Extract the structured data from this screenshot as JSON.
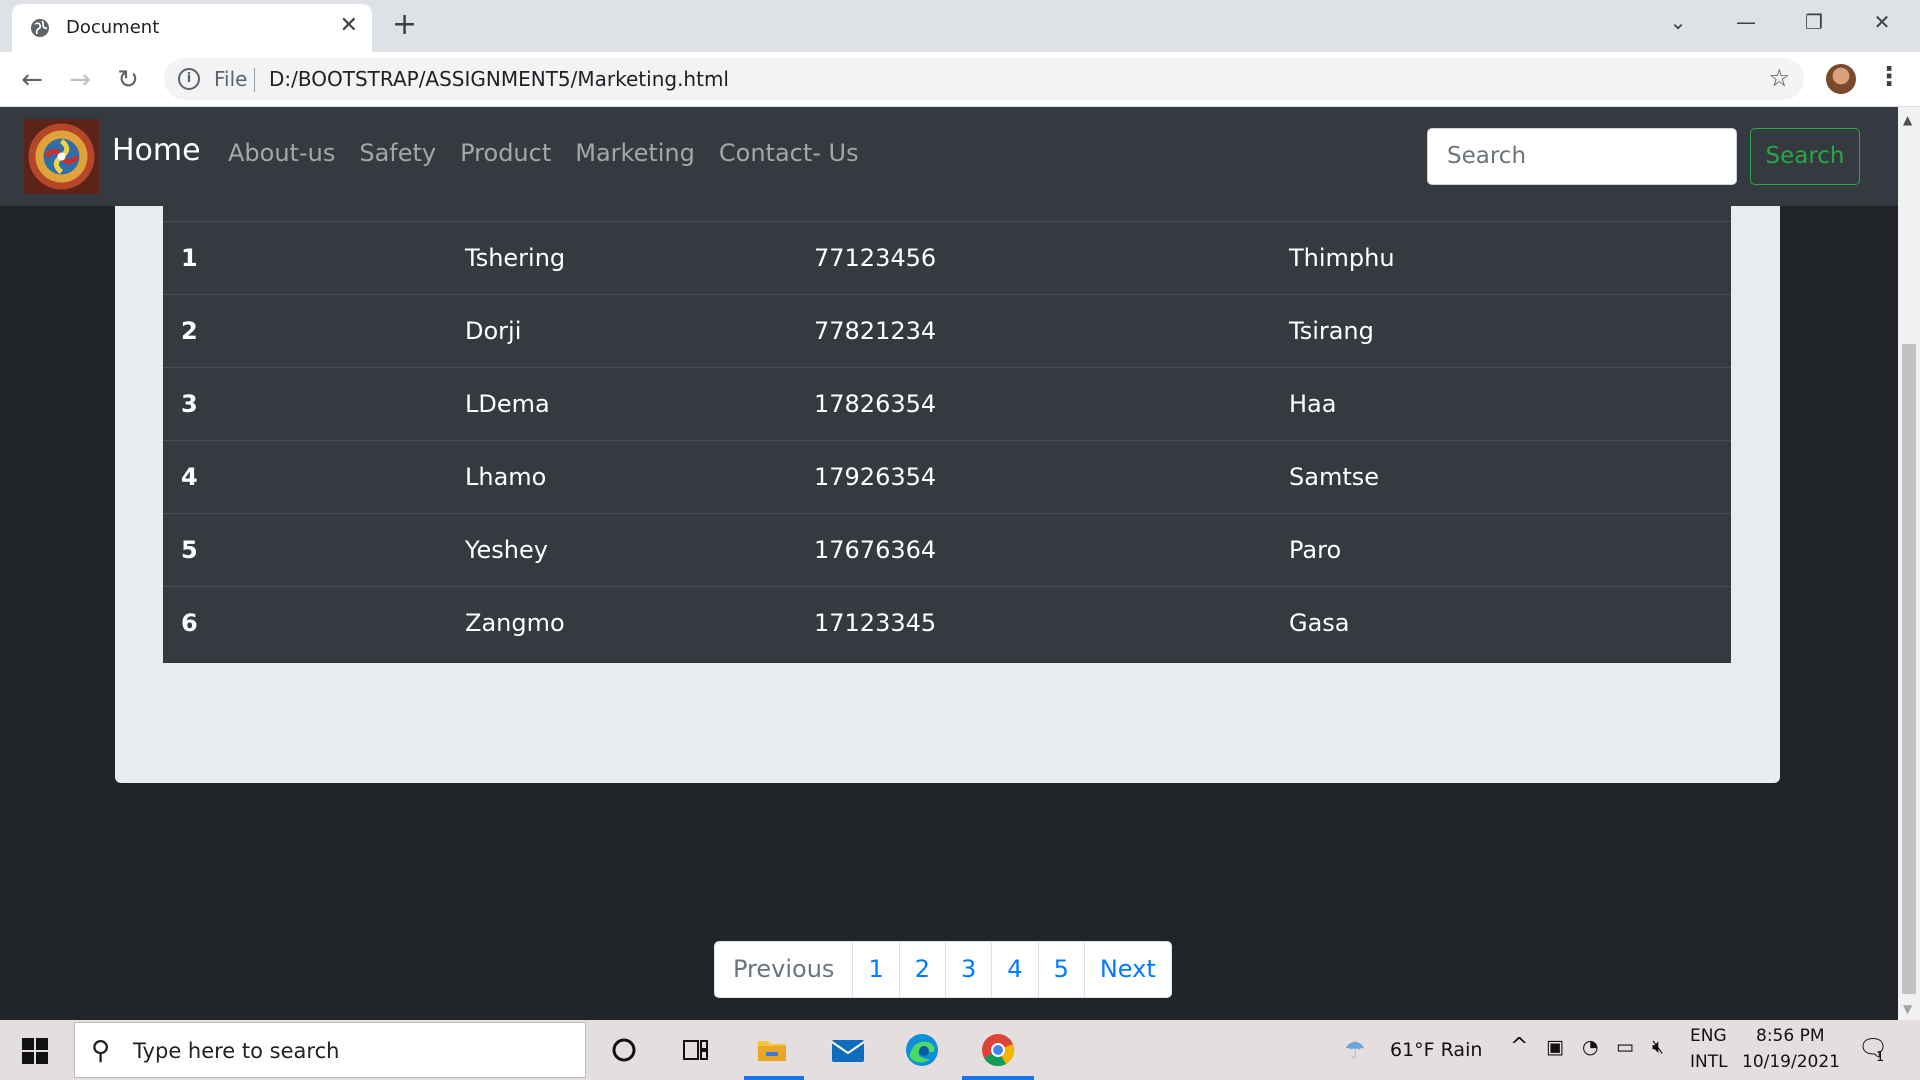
{
  "browser": {
    "tab_title": "Document",
    "file_label": "File",
    "url": "D:/BOOTSTRAP/ASSIGNMENT5/Marketing.html"
  },
  "navbar": {
    "brand": "Home",
    "links": [
      "About-us",
      "Safety",
      "Product",
      "Marketing",
      "Contact- Us"
    ],
    "search_placeholder": "Search",
    "search_button": "Search"
  },
  "table": {
    "rows": [
      [
        "1",
        "Tshering",
        "77123456",
        "Thimphu"
      ],
      [
        "2",
        "Dorji",
        "77821234",
        "Tsirang"
      ],
      [
        "3",
        "LDema",
        "17826354",
        "Haa"
      ],
      [
        "4",
        "Lhamo",
        "17926354",
        "Samtse"
      ],
      [
        "5",
        "Yeshey",
        "17676364",
        "Paro"
      ],
      [
        "6",
        "Zangmo",
        "17123345",
        "Gasa"
      ]
    ]
  },
  "pagination": [
    "Previous",
    "1",
    "2",
    "3",
    "4",
    "5",
    "Next"
  ],
  "taskbar": {
    "search_placeholder": "Type here to search",
    "weather": "61°F  Rain",
    "lang_top": "ENG",
    "lang_bottom": "INTL",
    "time": "8:56 PM",
    "date": "10/19/2021",
    "notifications": "1"
  }
}
